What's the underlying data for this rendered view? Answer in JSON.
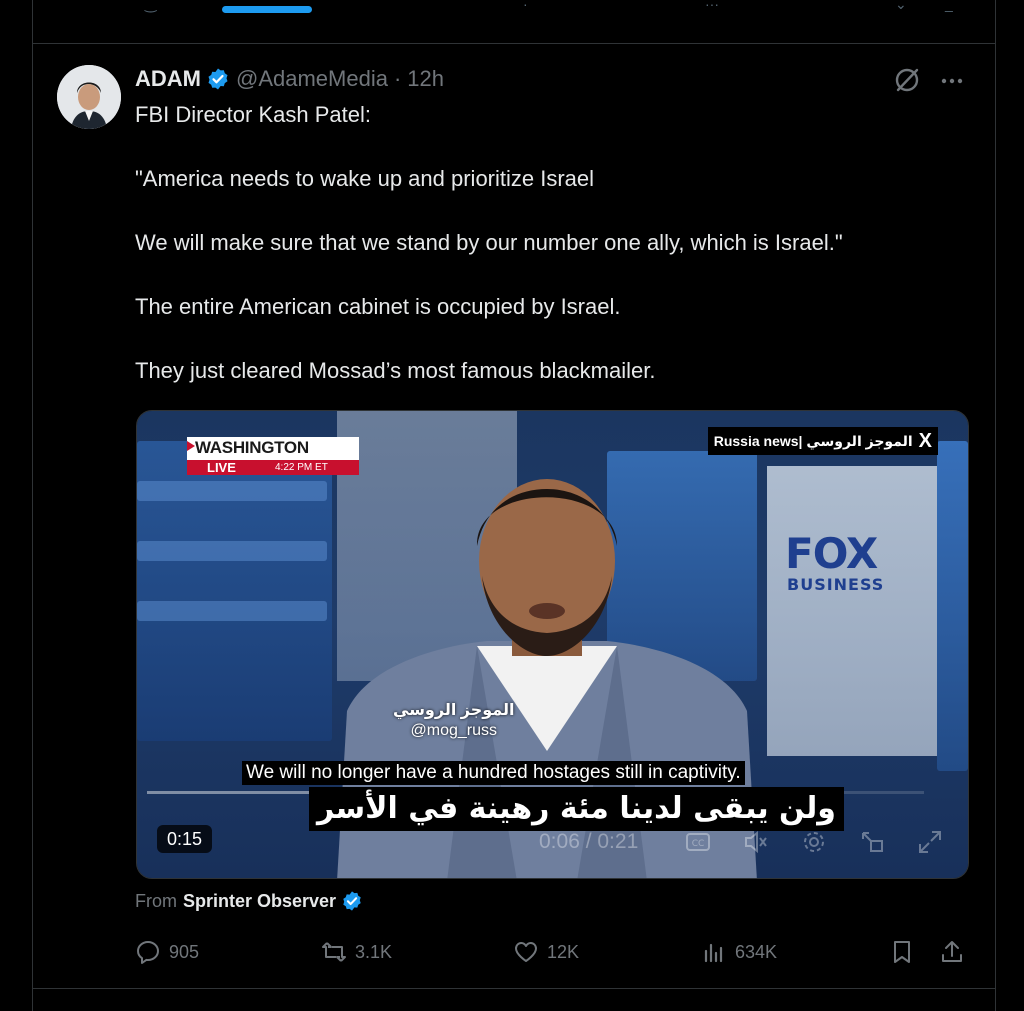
{
  "colors": {
    "accent": "#1d9bf0",
    "background": "#000000",
    "text": "#e7e9ea",
    "muted": "#71767b",
    "divider": "#2f3336"
  },
  "tweet": {
    "author_name": "ADAM",
    "handle": "@AdameMedia",
    "separator": "·",
    "time": "12h",
    "text_lines": [
      "FBI Director Kash Patel:",
      "\"America needs to wake up and prioritize Israel",
      "We will make sure that we stand by our number one ally, which is Israel.\"",
      "The entire American cabinet is occupied by Israel.",
      "They just cleared Mossad’s most famous blackmailer."
    ],
    "icons": {
      "verified": "verified-badge-icon",
      "grok": "grok-icon",
      "more": "more-icon"
    }
  },
  "video": {
    "location": "WASHINGTON",
    "live_label": "LIVE",
    "live_time": "4:22 PM ET",
    "channel_tag": "Russia news| الموجز الروسي",
    "channel_x": "X",
    "network_logo": "FOX",
    "network_sub": "BUSINESS",
    "watermark_ar": "الموجز الروسي",
    "watermark_handle": "@mog_russ",
    "caption_en": "We will no longer have a hundred hostages still in captivity.",
    "caption_ar": "ولن يبقى لدينا مئة رهينة في الأسر",
    "duration_badge": "0:15",
    "player_time": "0:06 / 0:21",
    "progress_fraction": 0.29
  },
  "source": {
    "label": "From",
    "name": "Sprinter Observer"
  },
  "actions": {
    "replies": "905",
    "reposts": "3.1K",
    "likes": "12K",
    "views": "634K"
  }
}
